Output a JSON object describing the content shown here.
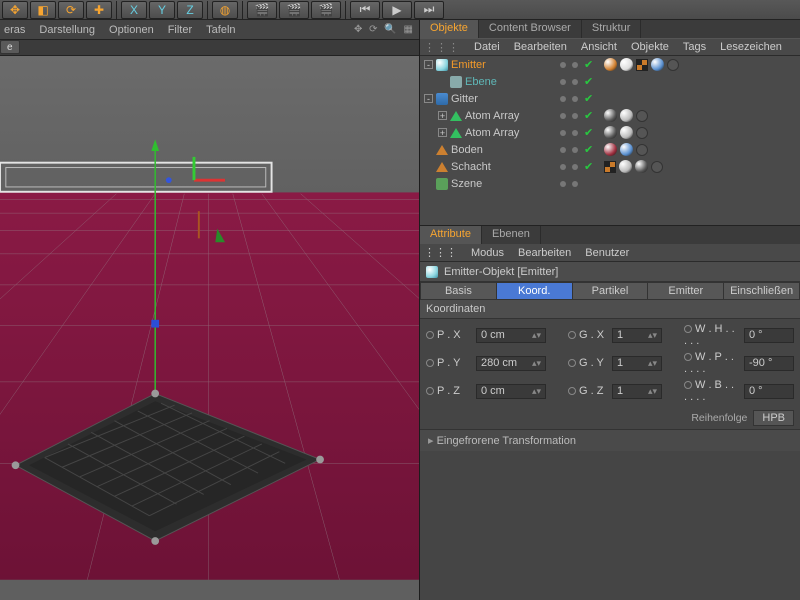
{
  "toolbar_icons": [
    "move",
    "scale",
    "rotate",
    "dup",
    "x",
    "y",
    "z",
    "cube",
    "clap1",
    "clap2",
    "clap3",
    "play1",
    "play2",
    "play3"
  ],
  "viewport_menus": [
    "eras",
    "Darstellung",
    "Optionen",
    "Filter",
    "Tafeln"
  ],
  "viewport_tab": "e",
  "panel_tabs": {
    "items": [
      "Objekte",
      "Content Browser",
      "Struktur"
    ],
    "active": 0
  },
  "panel_menus": [
    "Datei",
    "Bearbeiten",
    "Ansicht",
    "Objekte",
    "Tags",
    "Lesezeichen"
  ],
  "objects": [
    {
      "name": "Emitter",
      "cls": "orange",
      "icon": "emitter",
      "indent": 0,
      "exp": "-",
      "checks": true,
      "tags": [
        {
          "t": "ball",
          "c": "#d08030"
        },
        {
          "t": "ball",
          "c": "#dddddd"
        },
        {
          "t": "sq"
        },
        {
          "t": "ball",
          "c": "#5a90d0"
        },
        {
          "t": "cog"
        }
      ]
    },
    {
      "name": "Ebene",
      "cls": "teal",
      "icon": "plane",
      "indent": 1,
      "exp": "",
      "checks": true,
      "tags": []
    },
    {
      "name": "Gitter",
      "cls": "",
      "icon": "gitter",
      "indent": 0,
      "exp": "-",
      "checks": true,
      "tags": []
    },
    {
      "name": "Atom Array",
      "cls": "",
      "icon": "atom",
      "indent": 1,
      "exp": "+",
      "checks": true,
      "tags": [
        {
          "t": "ball",
          "c": "#555"
        },
        {
          "t": "ball",
          "c": "#bbb"
        },
        {
          "t": "cog"
        }
      ]
    },
    {
      "name": "Atom Array",
      "cls": "",
      "icon": "atom",
      "indent": 1,
      "exp": "+",
      "checks": true,
      "tags": [
        {
          "t": "ball",
          "c": "#555"
        },
        {
          "t": "ball",
          "c": "#bbb"
        },
        {
          "t": "cog"
        }
      ]
    },
    {
      "name": "Boden",
      "cls": "",
      "icon": "boden",
      "indent": 0,
      "exp": "",
      "checks": true,
      "tags": [
        {
          "t": "ball",
          "c": "#a03040"
        },
        {
          "t": "ball",
          "c": "#5a90d0"
        },
        {
          "t": "cog"
        }
      ]
    },
    {
      "name": "Schacht",
      "cls": "",
      "icon": "boden",
      "indent": 0,
      "exp": "",
      "checks": true,
      "tags": [
        {
          "t": "sq"
        },
        {
          "t": "ball",
          "c": "#bbb"
        },
        {
          "t": "ball",
          "c": "#555"
        },
        {
          "t": "cog"
        }
      ]
    },
    {
      "name": "Szene",
      "cls": "",
      "icon": "szene",
      "indent": 0,
      "exp": "",
      "checks": false,
      "tags": []
    }
  ],
  "attr_tabs": {
    "items": [
      "Attribute",
      "Ebenen"
    ],
    "active": 0
  },
  "attr_menus": [
    "Modus",
    "Bearbeiten",
    "Benutzer"
  ],
  "attr_title": "Emitter-Objekt [Emitter]",
  "prop_tabs": {
    "items": [
      "Basis",
      "Koord.",
      "Partikel",
      "Emitter",
      "Einschließen"
    ],
    "active": 1
  },
  "coord_header": "Koordinaten",
  "coords": {
    "p": {
      "x": "0 cm",
      "y": "280 cm",
      "z": "0 cm"
    },
    "g": {
      "x": "1",
      "y": "1",
      "z": "1"
    },
    "w": {
      "h": "0 °",
      "p": "-90 °",
      "b": "0 °"
    },
    "labels": {
      "px": "P . X",
      "py": "P . Y",
      "pz": "P . Z",
      "gx": "G . X",
      "gy": "G . Y",
      "gz": "G . Z",
      "wh": "W . H . . . . .",
      "wp": "W . P . . . . . .",
      "wb": "W . B . . . . . ."
    }
  },
  "order": {
    "label": "Reihenfolge",
    "value": "HPB"
  },
  "frozen": "Eingefrorene Transformation"
}
